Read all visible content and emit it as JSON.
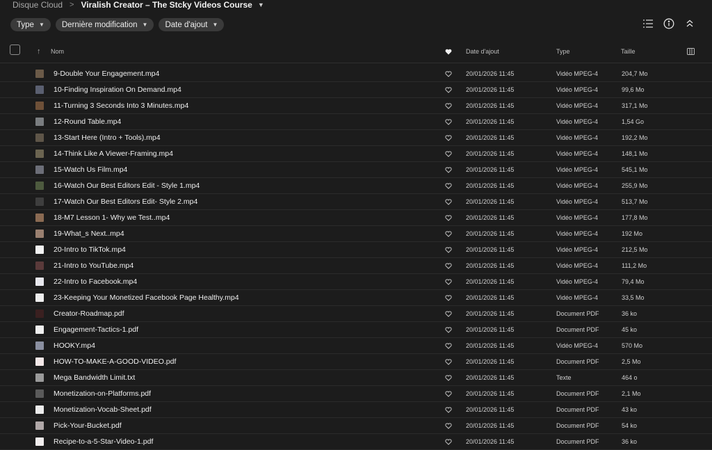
{
  "breadcrumb": {
    "root": "Disque Cloud",
    "separator": ">",
    "current": "Viralish Creator – The Stcky Videos Course"
  },
  "filters": [
    {
      "label": "Type"
    },
    {
      "label": "Dernière modification"
    },
    {
      "label": "Date d'ajout"
    }
  ],
  "columns": {
    "name": "Nom",
    "date": "Date d'ajout",
    "type": "Type",
    "size": "Taille"
  },
  "rows": [
    {
      "name": "9-Double Your Engagement.mp4",
      "date": "20/01/2026 11:45",
      "type": "Vidéo MPEG-4",
      "size": "204,7 Mo",
      "thumb": "#6b5a48"
    },
    {
      "name": "10-Finding Inspiration On Demand.mp4",
      "date": "20/01/2026 11:45",
      "type": "Vidéo MPEG-4",
      "size": "99,6 Mo",
      "thumb": "#5a5f70"
    },
    {
      "name": "11-Turning 3 Seconds Into 3 Minutes.mp4",
      "date": "20/01/2026 11:45",
      "type": "Vidéo MPEG-4",
      "size": "317,1 Mo",
      "thumb": "#6e5038"
    },
    {
      "name": "12-Round Table.mp4",
      "date": "20/01/2026 11:45",
      "type": "Vidéo MPEG-4",
      "size": "1,54 Go",
      "thumb": "#7a7d80"
    },
    {
      "name": "13-Start Here (Intro + Tools).mp4",
      "date": "20/01/2026 11:45",
      "type": "Vidéo MPEG-4",
      "size": "192,2 Mo",
      "thumb": "#5e5548"
    },
    {
      "name": "14-Think Like A Viewer-Framing.mp4",
      "date": "20/01/2026 11:45",
      "type": "Vidéo MPEG-4",
      "size": "148,1 Mo",
      "thumb": "#6b6450"
    },
    {
      "name": "15-Watch Us Film.mp4",
      "date": "20/01/2026 11:45",
      "type": "Vidéo MPEG-4",
      "size": "545,1 Mo",
      "thumb": "#6c6e78"
    },
    {
      "name": "16-Watch Our Best Editors Edit - Style 1.mp4",
      "date": "20/01/2026 11:45",
      "type": "Vidéo MPEG-4",
      "size": "255,9 Mo",
      "thumb": "#4d5a3e"
    },
    {
      "name": "17-Watch Our Best Editors Edit- Style 2.mp4",
      "date": "20/01/2026 11:45",
      "type": "Vidéo MPEG-4",
      "size": "513,7 Mo",
      "thumb": "#3e3e3e"
    },
    {
      "name": "18-M7 Lesson 1- Why we Test..mp4",
      "date": "20/01/2026 11:45",
      "type": "Vidéo MPEG-4",
      "size": "177,8 Mo",
      "thumb": "#8a6a52"
    },
    {
      "name": "19-What_s Next..mp4",
      "date": "20/01/2026 11:45",
      "type": "Vidéo MPEG-4",
      "size": "192 Mo",
      "thumb": "#9a8070"
    },
    {
      "name": "20-Intro to TikTok.mp4",
      "date": "20/01/2026 11:45",
      "type": "Vidéo MPEG-4",
      "size": "212,5 Mo",
      "thumb": "#f2f2f2"
    },
    {
      "name": "21-Intro to YouTube.mp4",
      "date": "20/01/2026 11:45",
      "type": "Vidéo MPEG-4",
      "size": "111,2 Mo",
      "thumb": "#5a3a3a"
    },
    {
      "name": "22-Intro to Facebook.mp4",
      "date": "20/01/2026 11:45",
      "type": "Vidéo MPEG-4",
      "size": "79,4 Mo",
      "thumb": "#e8e8ee"
    },
    {
      "name": "23-Keeping Your Monetized Facebook Page Healthy.mp4",
      "date": "20/01/2026 11:45",
      "type": "Vidéo MPEG-4",
      "size": "33,5 Mo",
      "thumb": "#eeeeee"
    },
    {
      "name": "Creator-Roadmap.pdf",
      "date": "20/01/2026 11:45",
      "type": "Document PDF",
      "size": "36 ko",
      "thumb": "#3a2020"
    },
    {
      "name": "Engagement-Tactics-1.pdf",
      "date": "20/01/2026 11:45",
      "type": "Document PDF",
      "size": "45 ko",
      "thumb": "#f0f0f0"
    },
    {
      "name": "HOOKY.mp4",
      "date": "20/01/2026 11:45",
      "type": "Vidéo MPEG-4",
      "size": "570 Mo",
      "thumb": "#8a8fa0"
    },
    {
      "name": "HOW-TO-MAKE-A-GOOD-VIDEO.pdf",
      "date": "20/01/2026 11:45",
      "type": "Document PDF",
      "size": "2,5 Mo",
      "thumb": "#f4e8e8"
    },
    {
      "name": "Mega Bandwidth Limit.txt",
      "date": "20/01/2026 11:45",
      "type": "Texte",
      "size": "464 o",
      "thumb": "#9a9a9a"
    },
    {
      "name": "Monetization-on-Platforms.pdf",
      "date": "20/01/2026 11:45",
      "type": "Document PDF",
      "size": "2,1 Mo",
      "thumb": "#5a5a5a"
    },
    {
      "name": "Monetization-Vocab-Sheet.pdf",
      "date": "20/01/2026 11:45",
      "type": "Document PDF",
      "size": "43 ko",
      "thumb": "#ececec"
    },
    {
      "name": "Pick-Your-Bucket.pdf",
      "date": "20/01/2026 11:45",
      "type": "Document PDF",
      "size": "54 ko",
      "thumb": "#b0a8a8"
    },
    {
      "name": "Recipe-to-a-5-Star-Video-1.pdf",
      "date": "20/01/2026 11:45",
      "type": "Document PDF",
      "size": "36 ko",
      "thumb": "#f2eeee"
    }
  ]
}
